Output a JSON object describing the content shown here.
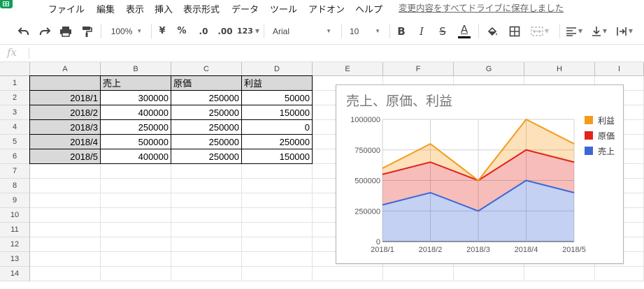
{
  "menu": {
    "items": [
      "ファイル",
      "編集",
      "表示",
      "挿入",
      "表示形式",
      "データ",
      "ツール",
      "アドオン",
      "ヘルプ"
    ],
    "save_status": "変更内容をすべてドライブに保存しました"
  },
  "toolbar": {
    "zoom": "100%",
    "currency": "¥",
    "percent": "%",
    "decrease_decimal": ".0",
    "increase_decimal": ".00",
    "more_formats": "123",
    "font": "Arial",
    "font_size": "10",
    "bold": "B",
    "italic": "I",
    "strikethrough": "S",
    "text_color_letter": "A",
    "text_color": "#000000"
  },
  "formula_bar": {
    "fx_label": "fx",
    "value": ""
  },
  "sheet": {
    "columns": [
      "A",
      "B",
      "C",
      "D",
      "E",
      "F",
      "G",
      "H",
      "I"
    ],
    "rows": [
      "1",
      "2",
      "3",
      "4",
      "5",
      "6",
      "7",
      "8",
      "9",
      "10",
      "11",
      "12",
      "13",
      "14"
    ],
    "header": [
      "",
      "売上",
      "原価",
      "利益"
    ],
    "data": [
      [
        "2018/1",
        "300000",
        "250000",
        "50000"
      ],
      [
        "2018/2",
        "400000",
        "250000",
        "150000"
      ],
      [
        "2018/3",
        "250000",
        "250000",
        "0"
      ],
      [
        "2018/4",
        "500000",
        "250000",
        "250000"
      ],
      [
        "2018/5",
        "400000",
        "250000",
        "150000"
      ]
    ]
  },
  "chart_data": {
    "type": "area",
    "stacked": true,
    "title": "売上、原価、利益",
    "categories": [
      "2018/1",
      "2018/2",
      "2018/3",
      "2018/4",
      "2018/5"
    ],
    "series": [
      {
        "name": "売上",
        "values": [
          300000,
          400000,
          250000,
          500000,
          400000
        ],
        "color": "#3c68d6"
      },
      {
        "name": "原価",
        "values": [
          250000,
          250000,
          250000,
          250000,
          250000
        ],
        "color": "#e1231a"
      },
      {
        "name": "利益",
        "values": [
          50000,
          150000,
          0,
          250000,
          150000
        ],
        "color": "#f49b1b"
      }
    ],
    "legend_order": [
      "利益",
      "原価",
      "売上"
    ],
    "legend_position": "right",
    "y_ticks": [
      "1000000",
      "750000",
      "500000",
      "250000",
      "0"
    ],
    "ylim": [
      0,
      1000000
    ],
    "grid": true,
    "xlabel": "",
    "ylabel": ""
  }
}
